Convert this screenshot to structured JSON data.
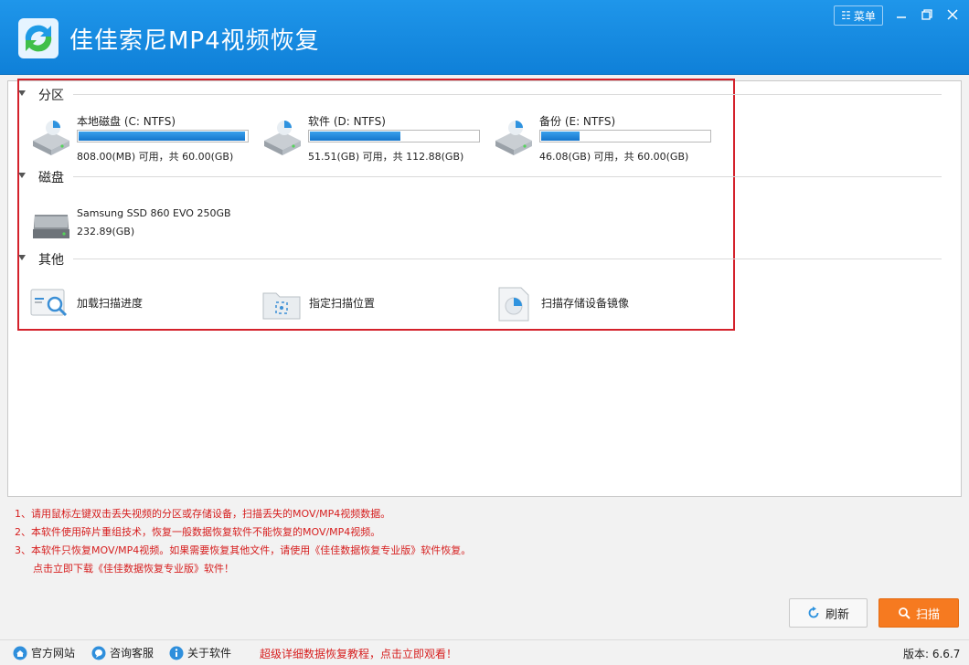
{
  "app": {
    "title": "佳佳索尼MP4视频恢复",
    "menu_label": "菜单",
    "accent": "#1a8ee3"
  },
  "sections": {
    "partitions": "分区",
    "disks": "磁盘",
    "others": "其他"
  },
  "partitions": [
    {
      "name": "本地磁盘 (C: NTFS)",
      "size": "808.00(MB) 可用，共 60.00(GB)",
      "used_fraction": 0.99
    },
    {
      "name": "软件 (D: NTFS)",
      "size": "51.51(GB) 可用，共 112.88(GB)",
      "used_fraction": 0.54
    },
    {
      "name": "备份 (E: NTFS)",
      "size": "46.08(GB) 可用，共 60.00(GB)",
      "used_fraction": 0.23
    }
  ],
  "disks": [
    {
      "name": "Samsung SSD 860 EVO 250GB",
      "size": "232.89(GB)"
    }
  ],
  "others": [
    {
      "label": "加载扫描进度",
      "icon": "load-progress-icon"
    },
    {
      "label": "指定扫描位置",
      "icon": "folder-target-icon"
    },
    {
      "label": "扫描存储设备镜像",
      "icon": "disk-image-icon"
    }
  ],
  "notes": [
    "1、请用鼠标左键双击丢失视频的分区或存储设备，扫描丢失的MOV/MP4视频数据。",
    "2、本软件使用碎片重组技术，恢复一般数据恢复软件不能恢复的MOV/MP4视频。",
    "3、本软件只恢复MOV/MP4视频。如果需要恢复其他文件，请使用《佳佳数据恢复专业版》软件恢复。",
    "点击立即下载《佳佳数据恢复专业版》软件！"
  ],
  "buttons": {
    "refresh": "刷新",
    "scan": "扫描"
  },
  "footer": {
    "website": "官方网站",
    "support": "咨询客服",
    "about": "关于软件",
    "promo": "超级详细数据恢复教程，点击立即观看！",
    "version": "版本: 6.6.7"
  }
}
